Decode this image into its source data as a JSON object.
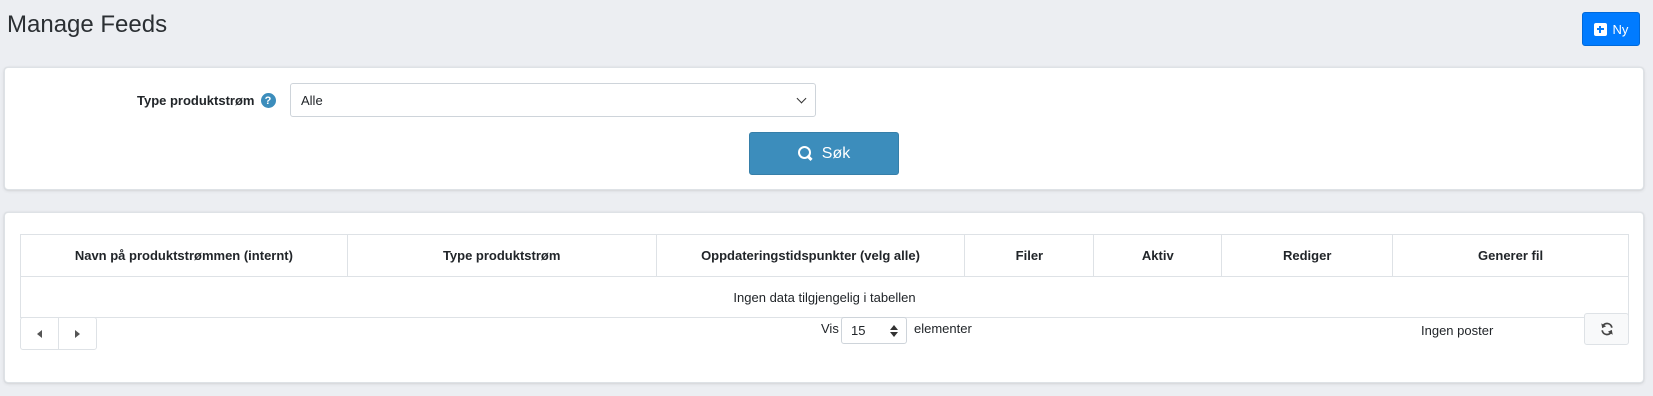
{
  "header": {
    "title": "Manage Feeds",
    "new_label": "Ny"
  },
  "filter": {
    "type_label": "Type produktstrøm",
    "help_glyph": "?",
    "type_value": "Alle",
    "search_label": "Søk"
  },
  "table": {
    "columns": [
      "Navn på produktstrømmen (internt)",
      "Type produktstrøm",
      "Oppdateringstidspunkter (velg alle)",
      "Filer",
      "Aktiv",
      "Rediger",
      "Generer fil"
    ],
    "empty_message": "Ingen data tilgjengelig i tabellen"
  },
  "footer": {
    "show_label": "Vis",
    "page_size": "15",
    "elements_label": "elementer",
    "records_info": "Ingen poster"
  },
  "colors": {
    "primary": "#007bff",
    "search": "#3c8dbc",
    "arrow": "#e8413a"
  }
}
